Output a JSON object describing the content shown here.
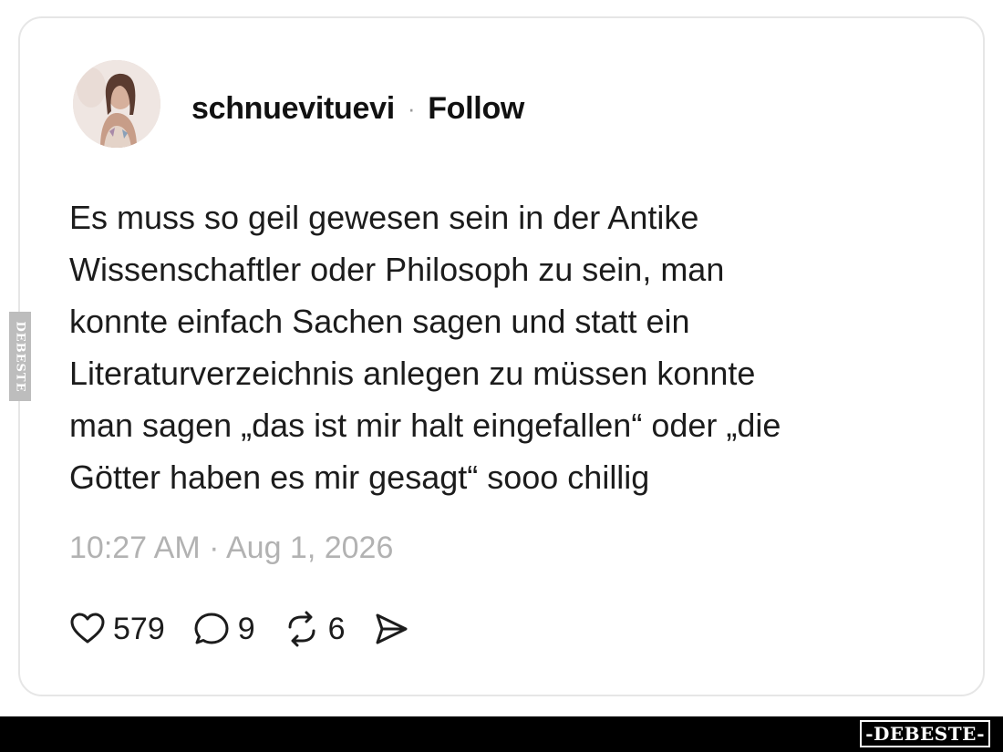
{
  "post": {
    "username": "schnuevituevi",
    "separator": "·",
    "follow_label": "Follow",
    "text_lines": [
      "Es muss so geil gewesen sein in der Antike",
      "Wissenschaftler oder Philosoph zu sein, man",
      "konnte einfach Sachen sagen und statt ein",
      "Literaturverzeichnis anlegen zu müssen konnte",
      "man sagen „das ist mir halt eingefallen“ oder „die",
      "Götter haben es mir gesagt“ sooo chillig"
    ],
    "timestamp": "10:27 AM · Aug 1, 2026",
    "likes": "579",
    "replies": "9",
    "reposts": "6"
  },
  "watermark": {
    "side": "DEBESTE",
    "bottom": "-DEBESTE-"
  },
  "colors": {
    "text": "#1c1c1c",
    "timestamp": "#b2b2b2",
    "card_border": "#e6e6e6",
    "bottom_bar": "#000000"
  },
  "icons": {
    "like": "heart-icon",
    "reply": "speech-bubble-icon",
    "repost": "repost-icon",
    "share": "send-icon"
  }
}
